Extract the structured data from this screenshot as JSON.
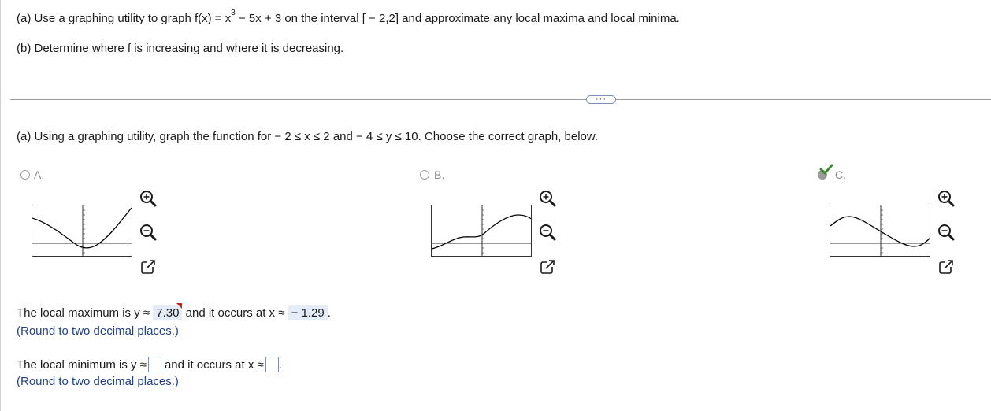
{
  "question": {
    "part_a_prefix": "(a) Use a graphing utility to graph f(x) = x",
    "part_a_exp": "3",
    "part_a_suffix": " − 5x + 3 on the interval [ − 2,2] and approximate any local maxima and local minima.",
    "part_b": "(b) Determine where f is increasing and where it is decreasing."
  },
  "more_button": "···",
  "instruction": "(a) Using a graphing utility, graph the function for  − 2 ≤ x ≤ 2 and  − 4 ≤ y ≤ 10.  Choose the correct graph, below.",
  "options": [
    {
      "label": "A.",
      "selected": false
    },
    {
      "label": "B.",
      "selected": false
    },
    {
      "label": "C.",
      "selected": true,
      "correct": true
    }
  ],
  "local_max": {
    "prefix": "The local maximum is y ≈",
    "y_value": "7.30",
    "middle": "and it occurs at x ≈",
    "x_value": " − 1.29",
    "suffix": ".",
    "hint": "(Round to two decimal places.)"
  },
  "local_min": {
    "prefix": "The local minimum is y ≈",
    "middle": "and it occurs at x ≈",
    "suffix": ".",
    "hint": "(Round to two decimal places.)"
  },
  "colors": {
    "hint_blue": "#1f3f8f",
    "answer_bg": "#e4ecf7",
    "check_green": "#3d8a2c",
    "incorrect_marker": "#c0281c"
  },
  "icons": [
    "zoom-in-icon",
    "zoom-out-icon",
    "open-new-window-icon",
    "checkmark-icon"
  ]
}
